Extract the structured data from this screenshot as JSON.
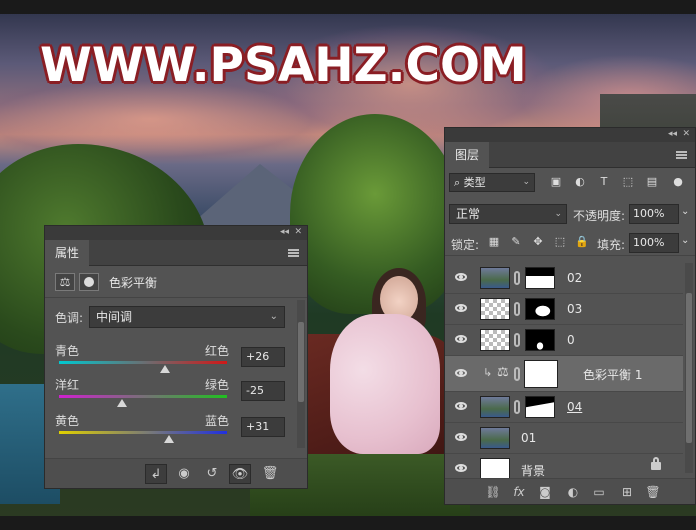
{
  "watermark": "WWW.PSAHZ.COM",
  "properties_panel": {
    "tab": "属性",
    "title": "色彩平衡",
    "tone_label": "色调:",
    "tone_value": "中间调",
    "sliders": [
      {
        "left": "青色",
        "right": "红色",
        "value": "+26",
        "position": 0.63
      },
      {
        "left": "洋红",
        "right": "绿色",
        "value": "-25",
        "position": 0.375
      },
      {
        "left": "黄色",
        "right": "蓝色",
        "value": "+31",
        "position": 0.655
      }
    ],
    "footer_icons": [
      "clip-to-layer-icon",
      "view-previous-icon",
      "reset-icon",
      "visibility-icon",
      "delete-icon"
    ]
  },
  "layers_panel": {
    "tab": "图层",
    "filter_kind": "类型",
    "blend_mode": "正常",
    "opacity_label": "不透明度:",
    "opacity_value": "100%",
    "lock_label": "锁定:",
    "fill_label": "填充:",
    "fill_value": "100%",
    "layers": [
      {
        "name": "02",
        "thumb": "photo",
        "mask": "m02",
        "selected": false
      },
      {
        "name": "03",
        "thumb": "checker",
        "mask": "m03",
        "selected": false
      },
      {
        "name": "0",
        "thumb": "checker",
        "mask": "m0",
        "selected": false
      },
      {
        "name": "色彩平衡 1",
        "thumb": "adjustment",
        "mask": "mwhite",
        "selected": true
      },
      {
        "name": "04",
        "thumb": "photo",
        "mask": "m04",
        "selected": false
      },
      {
        "name": "01",
        "thumb": "photo",
        "mask": "",
        "selected": false
      },
      {
        "name": "背景",
        "thumb": "white",
        "mask": "",
        "selected": false,
        "locked": true
      }
    ],
    "footer_icons": [
      "link-icon",
      "fx-icon",
      "add-mask-icon",
      "adjustment-icon",
      "folder-icon",
      "new-layer-icon",
      "delete-icon"
    ],
    "footer_fx_label": "fx"
  }
}
